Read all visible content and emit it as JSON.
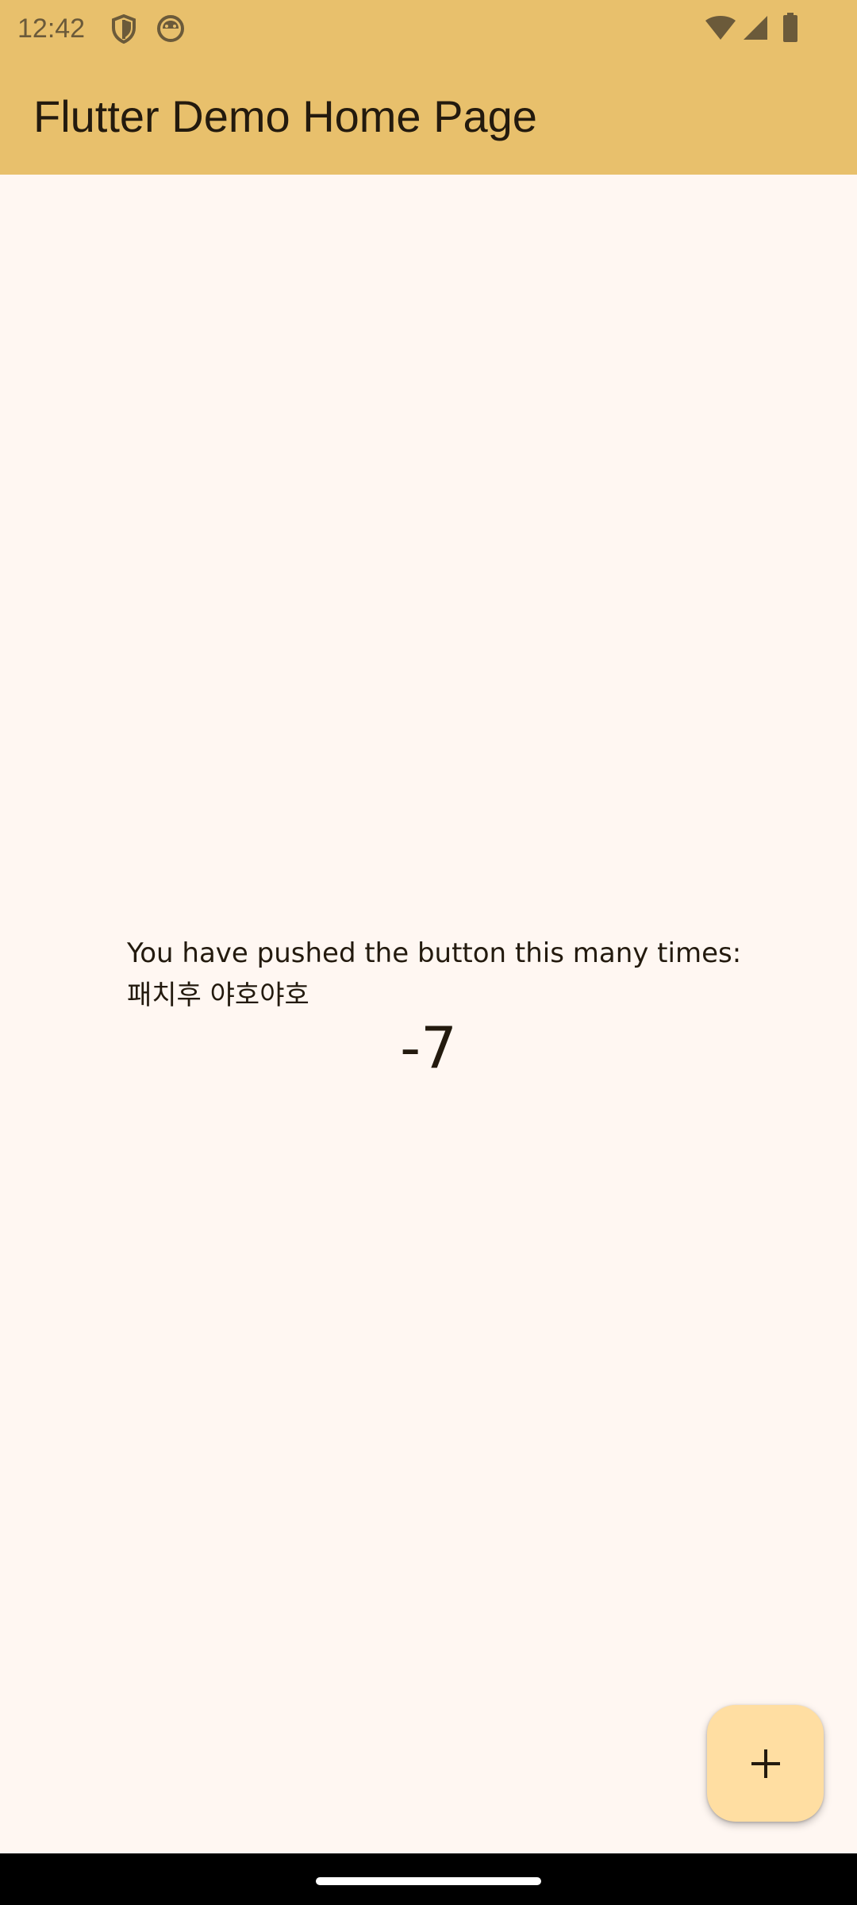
{
  "status_bar": {
    "time": "12:42",
    "icons_left": [
      "shield-icon",
      "android-debug-icon"
    ],
    "icons_right": [
      "wifi-icon",
      "cellular-signal-icon",
      "battery-icon"
    ]
  },
  "app_bar": {
    "title": "Flutter Demo Home Page",
    "color": "#e8c06c"
  },
  "body": {
    "message": "You have pushed the button this many times:",
    "submessage": "패치후 야호야호",
    "counter": "-7",
    "background": "#fff7f2"
  },
  "fab": {
    "icon": "add-icon",
    "color": "#ffdea2"
  },
  "nav_bar": {
    "handle": "home-gesture-handle"
  }
}
